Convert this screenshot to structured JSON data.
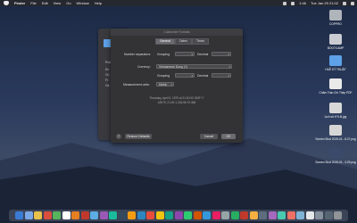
{
  "menubar": {
    "items": [
      "Finder",
      "File",
      "Edit",
      "View",
      "Go",
      "Window",
      "Help"
    ],
    "status": [
      "1:46"
    ],
    "clock": "Tue Jan 29 21:02"
  },
  "desktop_icons": [
    {
      "label": "COPPRO"
    },
    {
      "label": "BOOTCAMP"
    },
    {
      "label": "HUẾ KỶ THUẬT"
    },
    {
      "label": "Chăm Trần Chí Thép PDF"
    },
    {
      "label": "Lịch sử KYLB.jpg"
    },
    {
      "label": "Screen Shot 2019-01...8.27.png"
    },
    {
      "label": "Screen Shot 2019-01...3.29.png"
    }
  ],
  "bg_window": {
    "lines": [
      "Prot",
      "En",
      "Ch",
      "Fr",
      "Ge"
    ]
  },
  "dialog": {
    "title": "Customize Formats",
    "tabs": [
      "General",
      "Dates",
      "Times"
    ],
    "selected_tab": "General",
    "number_separators_label": "Number separators:",
    "grouping_label": "Grouping",
    "decimal_label": "Decimal",
    "currency_label": "Currency:",
    "currency_value": "Vietnamese Dong (₫)",
    "grouping_label_2": "Grouping",
    "decimal_label_2": "Decimal",
    "measurement_label": "Measurement units:",
    "measurement_value": "Metric",
    "sample_date": "Thursday, April 5, 1979 at 21:00:00 GMT+7",
    "sample_numbers": "4/5/79, 21:00     1.234,56     ₫0.456",
    "restore_label": "Restore Defaults",
    "cancel_label": "Cancel",
    "ok_label": "OK",
    "help_label": "?"
  },
  "dock_colors": [
    "#3a7bd5",
    "#7aa7e6",
    "#e8c14a",
    "#d94e3d",
    "#57b35c",
    "#ffffff",
    "#e67e22",
    "#c0392b",
    "#5dade2",
    "#9b59b6",
    "#1abc9c",
    "#34495e",
    "#f39c12",
    "#2e86c1",
    "#e74c3c",
    "#f1c40f",
    "#16a085",
    "#8e44ad",
    "#2ecc71",
    "#d35400",
    "#3498db",
    "#e91e63",
    "#95a5a6",
    "#27ae60",
    "#c0392b",
    "#f5b041",
    "#5d6d7e",
    "#a569bd",
    "#48c9b0",
    "#ec7063",
    "#7fb3d5",
    "#e5e8e8",
    "#85929e",
    "#566573",
    "#909497"
  ]
}
